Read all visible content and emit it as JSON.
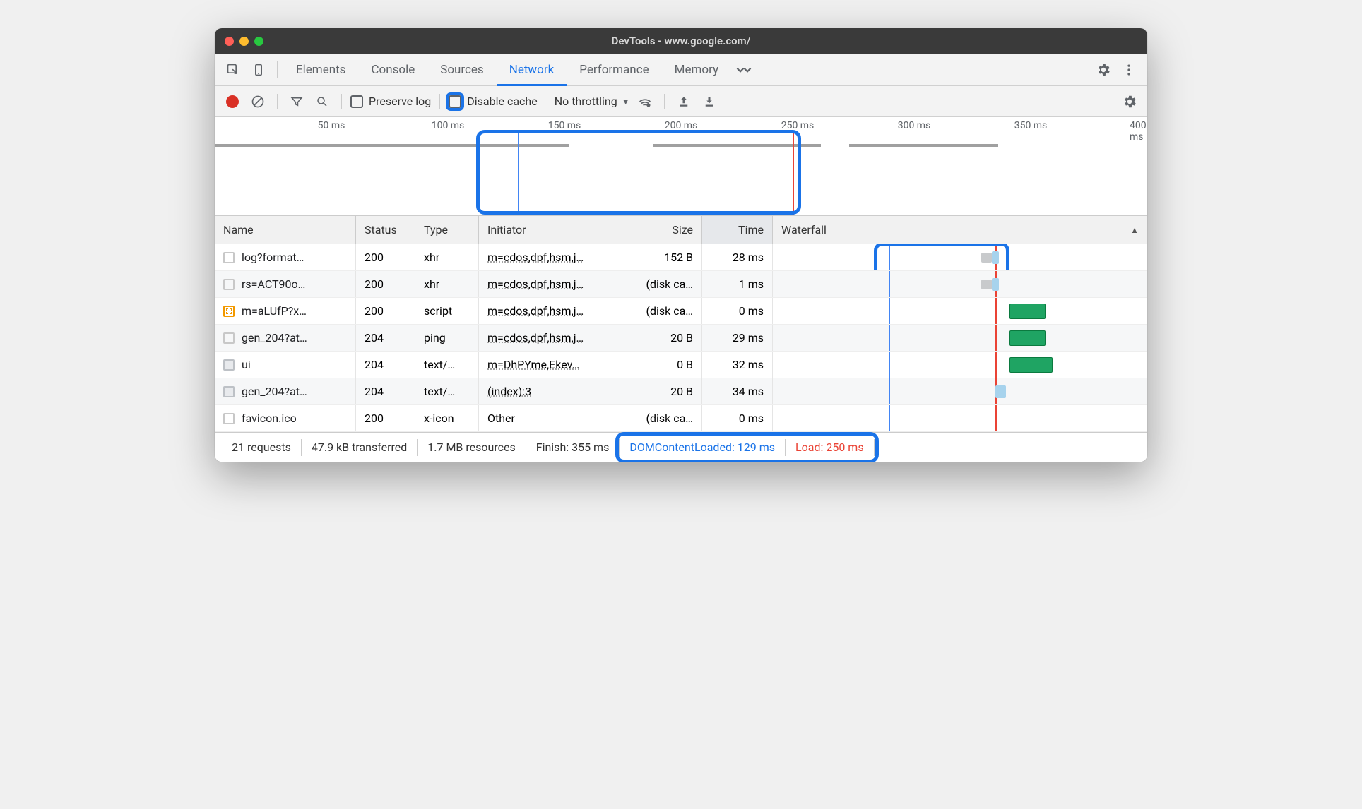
{
  "window": {
    "title": "DevTools - www.google.com/"
  },
  "tabs": {
    "elements": "Elements",
    "console": "Console",
    "sources": "Sources",
    "network": "Network",
    "performance": "Performance",
    "memory": "Memory"
  },
  "toolbar": {
    "preserve_log": "Preserve log",
    "disable_cache": "Disable cache",
    "throttling": "No throttling"
  },
  "timeline": {
    "ticks": [
      "50 ms",
      "100 ms",
      "150 ms",
      "200 ms",
      "250 ms",
      "300 ms",
      "350 ms",
      "400 ms"
    ]
  },
  "columns": {
    "name": "Name",
    "status": "Status",
    "type": "Type",
    "initiator": "Initiator",
    "size": "Size",
    "time": "Time",
    "waterfall": "Waterfall"
  },
  "rows": [
    {
      "name": "log?format…",
      "status": "200",
      "type": "xhr",
      "initiator": "m=cdos,dpf,hsm,j…",
      "size": "152 B",
      "time": "28 ms"
    },
    {
      "name": "rs=ACT90o…",
      "status": "200",
      "type": "xhr",
      "initiator": "m=cdos,dpf,hsm,j…",
      "size": "(disk ca…",
      "time": "1 ms"
    },
    {
      "name": "m=aLUfP?x…",
      "status": "200",
      "type": "script",
      "initiator": "m=cdos,dpf,hsm,j…",
      "size": "(disk ca…",
      "time": "0 ms"
    },
    {
      "name": "gen_204?at…",
      "status": "204",
      "type": "ping",
      "initiator": "m=cdos,dpf,hsm,j…",
      "size": "20 B",
      "time": "29 ms"
    },
    {
      "name": "ui",
      "status": "204",
      "type": "text/…",
      "initiator": "m=DhPYme,Ekev…",
      "size": "0 B",
      "time": "32 ms"
    },
    {
      "name": "gen_204?at…",
      "status": "204",
      "type": "text/…",
      "initiator": "(index):3",
      "size": "20 B",
      "time": "34 ms"
    },
    {
      "name": "favicon.ico",
      "status": "200",
      "type": "x-icon",
      "initiator": "Other",
      "size": "(disk ca…",
      "time": "0 ms"
    }
  ],
  "statusbar": {
    "requests": "21 requests",
    "transferred": "47.9 kB transferred",
    "resources": "1.7 MB resources",
    "finish": "Finish: 355 ms",
    "dom": "DOMContentLoaded: 129 ms",
    "load": "Load: 250 ms"
  }
}
